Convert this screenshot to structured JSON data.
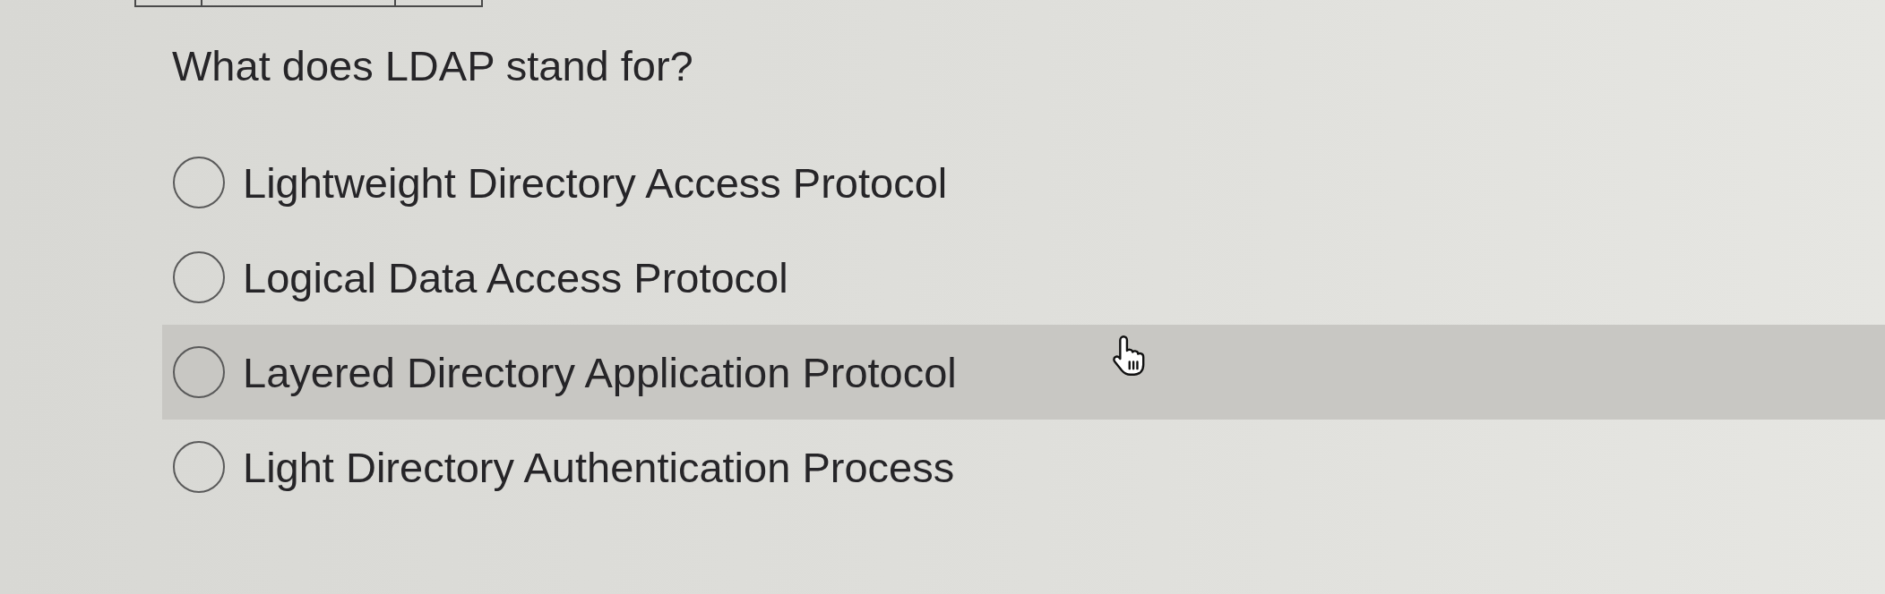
{
  "question": {
    "text": "What does LDAP stand for?"
  },
  "options": [
    {
      "label": "Lightweight Directory Access Protocol",
      "selected": false,
      "hovered": false
    },
    {
      "label": "Logical Data Access Protocol",
      "selected": false,
      "hovered": false
    },
    {
      "label": "Layered Directory Application Protocol",
      "selected": false,
      "hovered": true
    },
    {
      "label": "Light Directory Authentication Process",
      "selected": false,
      "hovered": false
    }
  ]
}
